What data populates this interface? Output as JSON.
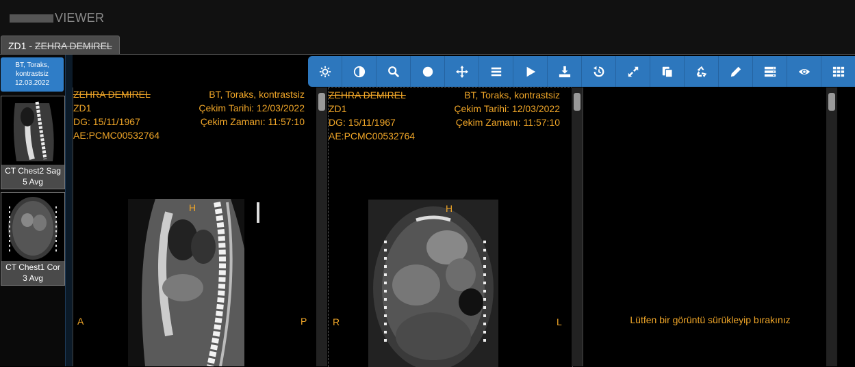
{
  "app": {
    "title_visible": "VIEWER"
  },
  "tab": {
    "prefix": "ZD1 - ",
    "patient_name": "ZEHRA DEMIREL"
  },
  "study": {
    "line1": "BT, Toraks,",
    "line2": "kontrastsiz",
    "date": "12.03.2022"
  },
  "series": [
    {
      "line1": "CT Chest2 Sag",
      "line2": "5 Avg"
    },
    {
      "line1": "CT Chest1 Cor",
      "line2": "3 Avg"
    }
  ],
  "toolbar": {
    "icons": [
      "brightness-icon",
      "contrast-icon",
      "zoom-icon",
      "circle-icon",
      "pan-icon",
      "menu-icon",
      "play-icon",
      "download-icon",
      "reset-icon",
      "fullscreen-icon",
      "copy-icon",
      "recycle-icon",
      "pencil-icon",
      "series-list-icon",
      "eye-icon",
      "grid-layout-icon"
    ],
    "accent": "#2d77bd"
  },
  "viewport1": {
    "name": "ZEHRA DEMIREL",
    "id": "ZD1",
    "dob": "DG: 15/11/1967",
    "ae": "AE:PCMC00532764",
    "study": "BT, Toraks, kontrastsiz",
    "date": "Çekim Tarihi: 12/03/2022",
    "time": "Çekim Zamanı: 11:57:10",
    "top": "H",
    "left": "A",
    "right": "P"
  },
  "viewport2": {
    "name": "ZEHRA DEMIREL",
    "id": "ZD1",
    "dob": "DG: 15/11/1967",
    "ae": "AE:PCMC00532764",
    "study": "BT, Toraks, kontrastsiz",
    "date": "Çekim Tarihi: 12/03/2022",
    "time": "Çekim Zamanı: 11:57:10",
    "top": "H",
    "left": "R",
    "right": "L"
  },
  "viewport3": {
    "message": "Lütfen bir görüntü sürükleyip bırakınız"
  },
  "colors": {
    "overlay_text": "#f0a628",
    "study_card": "#2f7dc7"
  }
}
